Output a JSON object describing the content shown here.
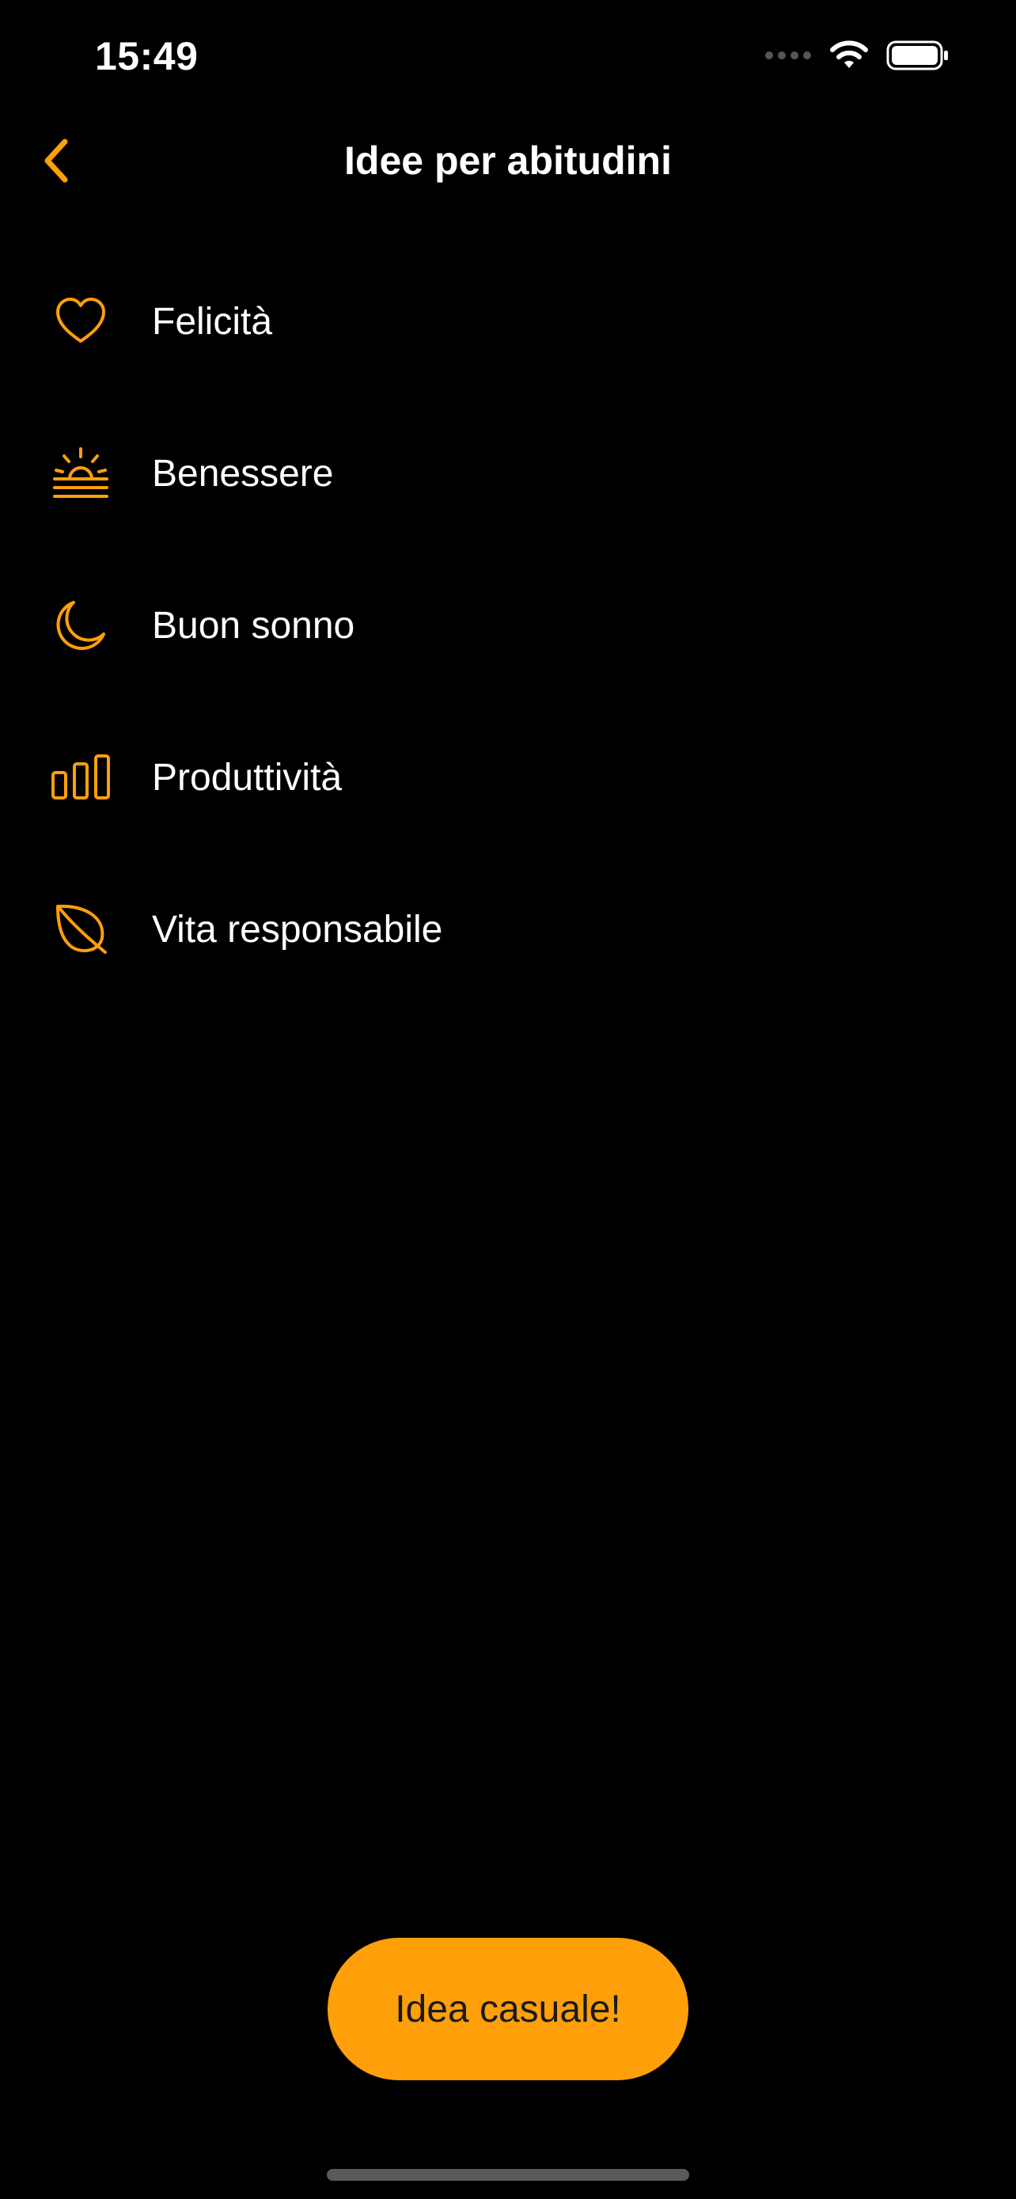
{
  "status_bar": {
    "time": "15:49",
    "icons": [
      "cellular-signal-icon",
      "wifi-icon",
      "battery-icon"
    ]
  },
  "nav": {
    "back_icon": "chevron-left-icon",
    "title": "Idee per abitudini"
  },
  "categories": [
    {
      "label": "Felicità",
      "icon": "heart-icon"
    },
    {
      "label": "Benessere",
      "icon": "sunrise-icon"
    },
    {
      "label": "Buon sonno",
      "icon": "moon-icon"
    },
    {
      "label": "Produttività",
      "icon": "bar-chart-icon"
    },
    {
      "label": "Vita responsabile",
      "icon": "leaf-icon"
    }
  ],
  "random_button": {
    "label": "Idea casuale!"
  },
  "colors": {
    "accent": "#ff9f0a",
    "background": "#000000",
    "text": "#ffffff"
  }
}
